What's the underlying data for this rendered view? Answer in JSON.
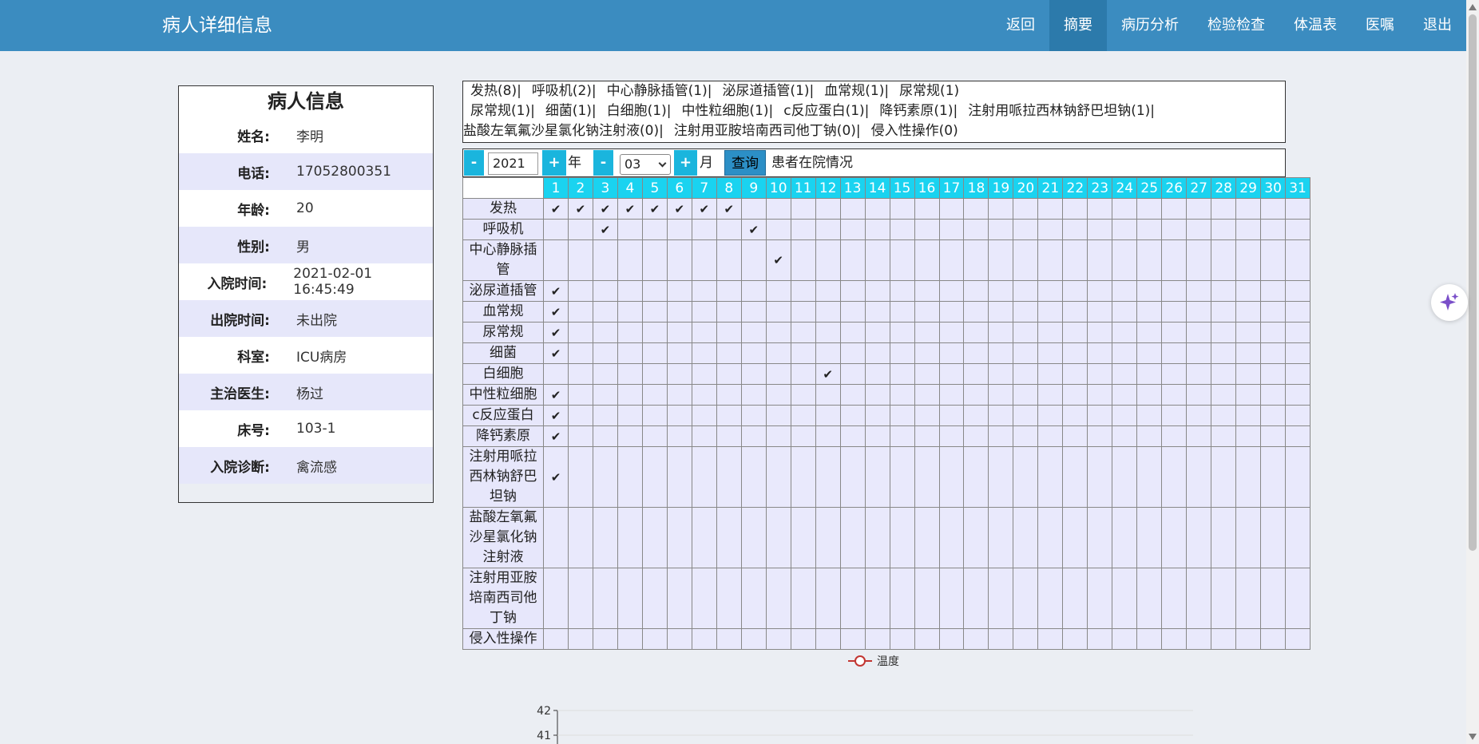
{
  "header": {
    "title": "病人详细信息",
    "nav": [
      {
        "label": "返回",
        "active": false
      },
      {
        "label": "摘要",
        "active": true
      },
      {
        "label": "病历分析",
        "active": false
      },
      {
        "label": "检验检查",
        "active": false
      },
      {
        "label": "体温表",
        "active": false
      },
      {
        "label": "医嘱",
        "active": false
      },
      {
        "label": "退出",
        "active": false
      }
    ]
  },
  "patient": {
    "title": "病人信息",
    "fields": [
      {
        "label": "姓名:",
        "value": "李明"
      },
      {
        "label": "电话:",
        "value": "17052800351"
      },
      {
        "label": "年龄:",
        "value": "20"
      },
      {
        "label": "性别:",
        "value": "男"
      },
      {
        "label": "入院时间:",
        "value": "2021-02-01 16:45:49"
      },
      {
        "label": "出院时间:",
        "value": "未出院"
      },
      {
        "label": "科室:",
        "value": "ICU病房"
      },
      {
        "label": "主治医生:",
        "value": "杨过"
      },
      {
        "label": "床号:",
        "value": "103-1"
      },
      {
        "label": "入院诊断:",
        "value": "禽流感"
      }
    ]
  },
  "tags": [
    "发热(8)|",
    "呼吸机(2)|",
    "中心静脉插管(1)|",
    "泌尿道插管(1)|",
    "血常规(1)|",
    "尿常规(1)",
    "尿常规(1)|",
    "细菌(1)|",
    "白细胞(1)|",
    "中性粒细胞(1)|",
    "c反应蛋白(1)|",
    "降钙素原(1)|",
    "注射用哌拉西林钠舒巴坦钠(1)|",
    "盐酸左氧氟沙星氯化钠注射液(0)|",
    "注射用亚胺培南西司他丁钠(0)|",
    "侵入性操作(0)"
  ],
  "toolbar": {
    "minus": "-",
    "plus": "+",
    "year": "2021",
    "year_unit": "年",
    "month": "03",
    "month_unit": "月",
    "query": "查询",
    "status": "患者在院情况"
  },
  "grid": {
    "days": [
      "1",
      "2",
      "3",
      "4",
      "5",
      "6",
      "7",
      "8",
      "9",
      "10",
      "11",
      "12",
      "13",
      "14",
      "15",
      "16",
      "17",
      "18",
      "19",
      "20",
      "21",
      "22",
      "23",
      "24",
      "25",
      "26",
      "27",
      "28",
      "29",
      "30",
      "31"
    ],
    "rows": [
      {
        "label": "发热",
        "lines": 1,
        "checked": [
          1,
          2,
          3,
          4,
          5,
          6,
          7,
          8
        ]
      },
      {
        "label": "呼吸机",
        "lines": 1,
        "checked": [
          3,
          9
        ]
      },
      {
        "label": "中心静脉插管",
        "lines": 2,
        "checked": [
          10
        ]
      },
      {
        "label": "泌尿道插管",
        "lines": 1,
        "checked": [
          1
        ]
      },
      {
        "label": "血常规",
        "lines": 1,
        "checked": [
          1
        ]
      },
      {
        "label": "尿常规",
        "lines": 1,
        "checked": [
          1
        ]
      },
      {
        "label": "细菌",
        "lines": 1,
        "checked": [
          1
        ]
      },
      {
        "label": "白细胞",
        "lines": 1,
        "checked": [
          12
        ]
      },
      {
        "label": "中性粒细胞",
        "lines": 1,
        "checked": [
          1
        ]
      },
      {
        "label": "c反应蛋白",
        "lines": 1,
        "checked": [
          1
        ]
      },
      {
        "label": "降钙素原",
        "lines": 1,
        "checked": [
          1
        ]
      },
      {
        "label": "注射用哌拉西林钠舒巴坦钠",
        "lines": 3,
        "checked": [
          1
        ]
      },
      {
        "label": "盐酸左氧氟沙星氯化钠注射液",
        "lines": 3,
        "checked": []
      },
      {
        "label": "注射用亚胺培南西司他丁钠",
        "lines": 3,
        "checked": []
      },
      {
        "label": "侵入性操作",
        "lines": 1,
        "checked": []
      }
    ]
  },
  "chart_data": {
    "type": "line",
    "series": [
      {
        "name": "温度",
        "values": []
      }
    ],
    "ytick_labels": [
      "42",
      "41"
    ],
    "colors": {
      "series": "#c23531"
    }
  }
}
